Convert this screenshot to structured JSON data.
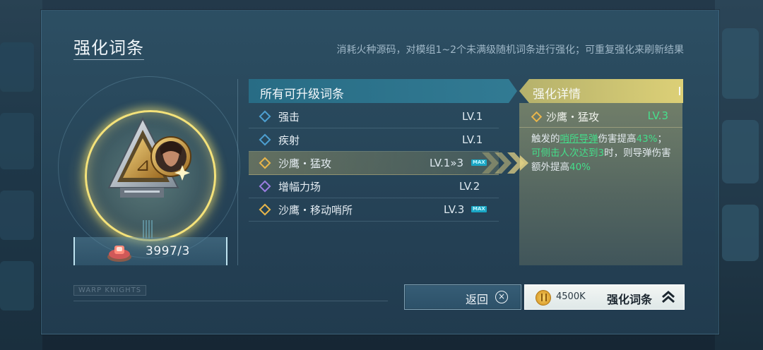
{
  "page": {
    "title": "强化词条",
    "subtitle": "消耗火种源码，对模组1~2个未满级随机词条进行强化；可重复强化来刷新结果",
    "watermark": "WARP KNIGHTS"
  },
  "resource": {
    "icon": "gem-icon",
    "count": "3997/3"
  },
  "list": {
    "header": "所有可升级词条",
    "items": [
      {
        "name": "强击",
        "level": "LV.1",
        "diamond": "blue",
        "max": false,
        "selected": false
      },
      {
        "name": "疾射",
        "level": "LV.1",
        "diamond": "blue",
        "max": false,
        "selected": false
      },
      {
        "name": "沙鹰・猛攻",
        "level": "LV.1»3",
        "diamond": "gold",
        "max": true,
        "selected": true
      },
      {
        "name": "增幅力场",
        "level": "LV.2",
        "diamond": "purple",
        "max": false,
        "selected": false
      },
      {
        "name": "沙鹰・移动哨所",
        "level": "LV.3",
        "diamond": "gold",
        "max": true,
        "selected": false
      }
    ],
    "max_badge": "MAX"
  },
  "detail": {
    "header": "强化详情",
    "name": "沙鹰・猛攻",
    "level": "LV.3",
    "desc": {
      "p1": "触发的",
      "h1": "哨所导弹",
      "p2": "伤害提高",
      "h2": "43%",
      "p3": "；",
      "h3": "可侧击人次达到3",
      "p4": "时，则导弹伤害额外提高",
      "h4": "40%"
    }
  },
  "buttons": {
    "back_label": "返回",
    "back_icon": "⊗",
    "upgrade_cost": "4500K",
    "upgrade_label": "强化词条"
  },
  "colors": {
    "accent_gold": "#f4e27a",
    "highlight_green": "#44dd8a",
    "header_blue": "#2f7d96"
  }
}
